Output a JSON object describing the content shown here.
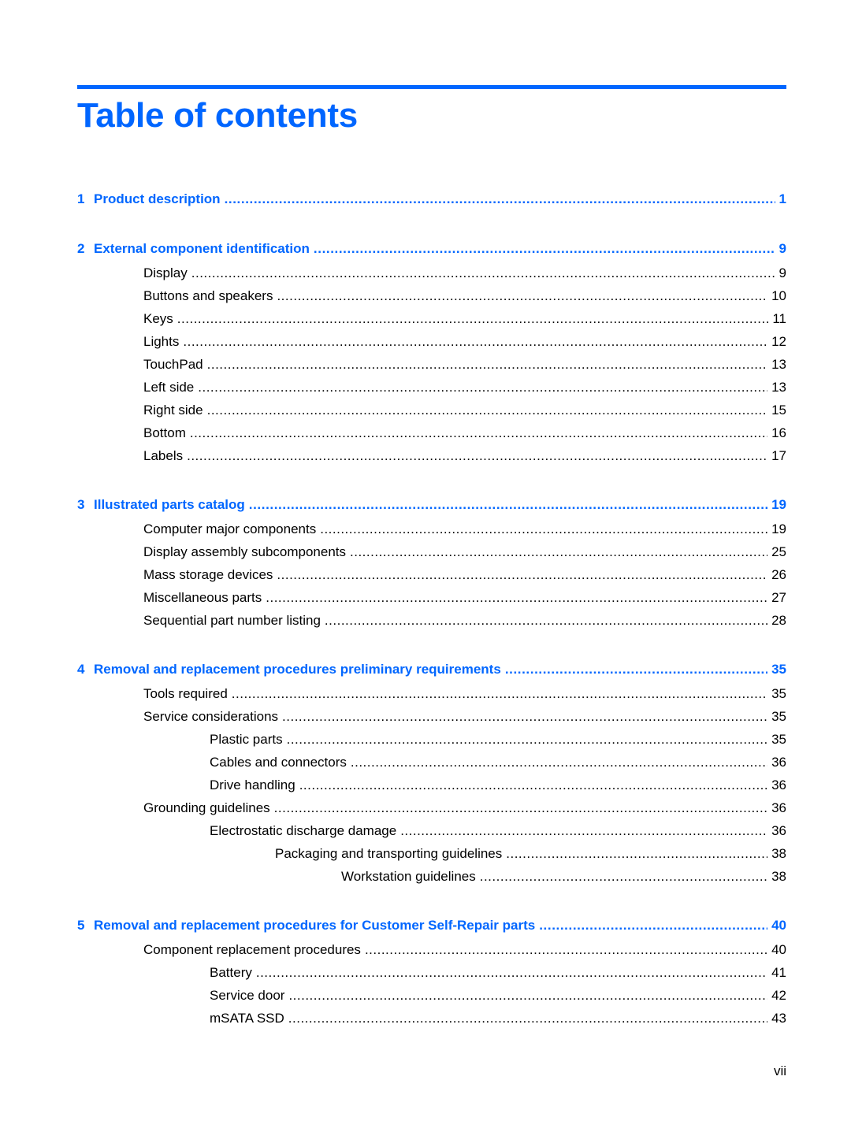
{
  "document": {
    "title": "Table of contents",
    "accent_color": "#0066ff",
    "page_folio": "vii"
  },
  "toc": [
    {
      "level": 0,
      "number": "1",
      "label": "Product description",
      "page": "1"
    },
    {
      "level": 0,
      "number": "2",
      "label": "External component identification",
      "page": "9"
    },
    {
      "level": 1,
      "label": "Display",
      "page": "9"
    },
    {
      "level": 1,
      "label": "Buttons and speakers",
      "page": "10"
    },
    {
      "level": 1,
      "label": "Keys",
      "page": "11"
    },
    {
      "level": 1,
      "label": "Lights",
      "page": "12"
    },
    {
      "level": 1,
      "label": "TouchPad",
      "page": "13"
    },
    {
      "level": 1,
      "label": "Left side",
      "page": "13"
    },
    {
      "level": 1,
      "label": "Right side",
      "page": "15"
    },
    {
      "level": 1,
      "label": "Bottom",
      "page": "16"
    },
    {
      "level": 1,
      "label": "Labels",
      "page": "17"
    },
    {
      "level": 0,
      "number": "3",
      "label": "Illustrated parts catalog",
      "page": "19"
    },
    {
      "level": 1,
      "label": "Computer major components",
      "page": "19"
    },
    {
      "level": 1,
      "label": "Display assembly subcomponents",
      "page": "25"
    },
    {
      "level": 1,
      "label": "Mass storage devices",
      "page": "26"
    },
    {
      "level": 1,
      "label": "Miscellaneous parts",
      "page": "27"
    },
    {
      "level": 1,
      "label": "Sequential part number listing",
      "page": "28"
    },
    {
      "level": 0,
      "number": "4",
      "label": "Removal and replacement procedures preliminary requirements",
      "page": "35"
    },
    {
      "level": 1,
      "label": "Tools required",
      "page": "35"
    },
    {
      "level": 1,
      "label": "Service considerations",
      "page": "35"
    },
    {
      "level": 2,
      "label": "Plastic parts",
      "page": "35"
    },
    {
      "level": 2,
      "label": "Cables and connectors",
      "page": "36"
    },
    {
      "level": 2,
      "label": "Drive handling",
      "page": "36"
    },
    {
      "level": 1,
      "label": "Grounding guidelines",
      "page": "36"
    },
    {
      "level": 2,
      "label": "Electrostatic discharge damage",
      "page": "36"
    },
    {
      "level": 3,
      "label": "Packaging and transporting guidelines",
      "page": "38"
    },
    {
      "level": 4,
      "label": "Workstation guidelines",
      "page": "38"
    },
    {
      "level": 0,
      "number": "5",
      "label": "Removal and replacement procedures for Customer Self-Repair parts",
      "page": "40"
    },
    {
      "level": 1,
      "label": "Component replacement procedures",
      "page": "40"
    },
    {
      "level": 2,
      "label": "Battery",
      "page": "41"
    },
    {
      "level": 2,
      "label": "Service door",
      "page": "42"
    },
    {
      "level": 2,
      "label": "mSATA SSD",
      "page": "43"
    }
  ]
}
